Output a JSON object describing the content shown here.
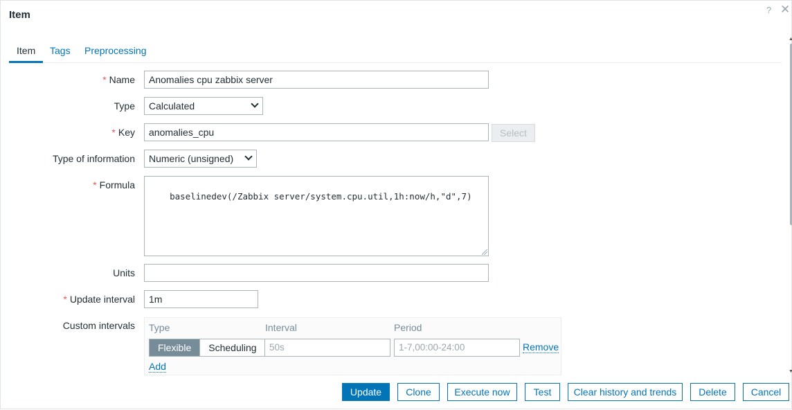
{
  "dialog": {
    "title": "Item",
    "help_icon": "?",
    "close_icon": "✕"
  },
  "tabs": [
    {
      "label": "Item",
      "active": true
    },
    {
      "label": "Tags",
      "active": false
    },
    {
      "label": "Preprocessing",
      "active": false
    }
  ],
  "form": {
    "name": {
      "label": "Name",
      "required": true,
      "value": "Anomalies cpu zabbix server"
    },
    "type": {
      "label": "Type",
      "value": "Calculated"
    },
    "key": {
      "label": "Key",
      "required": true,
      "value": "anomalies_cpu",
      "select_label": "Select"
    },
    "type_of_information": {
      "label": "Type of information",
      "value": "Numeric (unsigned)"
    },
    "formula": {
      "label": "Formula",
      "required": true,
      "value": "baselinedev(/Zabbix server/system.cpu.util,1h:now/h,\"d\",7)"
    },
    "units": {
      "label": "Units",
      "value": ""
    },
    "update_interval": {
      "label": "Update interval",
      "required": true,
      "value": "1m"
    },
    "custom_intervals": {
      "label": "Custom intervals",
      "headers": {
        "type": "Type",
        "interval": "Interval",
        "period": "Period"
      },
      "toggle": {
        "flexible": "Flexible",
        "scheduling": "Scheduling",
        "selected": "Flexible"
      },
      "interval_placeholder": "50s",
      "period_placeholder": "1-7,00:00-24:00",
      "remove_label": "Remove",
      "add_label": "Add"
    }
  },
  "footer": {
    "update": "Update",
    "clone": "Clone",
    "execute_now": "Execute now",
    "test": "Test",
    "clear_history": "Clear history and trends",
    "delete": "Delete",
    "cancel": "Cancel"
  },
  "colors": {
    "accent": "#0275b8",
    "required": "#e45959",
    "toggle_active": "#768d99"
  },
  "icons": {
    "help": "help-icon",
    "close": "close-icon",
    "dropdown": "chevron-down-icon",
    "resize": "resize-grip-icon"
  }
}
